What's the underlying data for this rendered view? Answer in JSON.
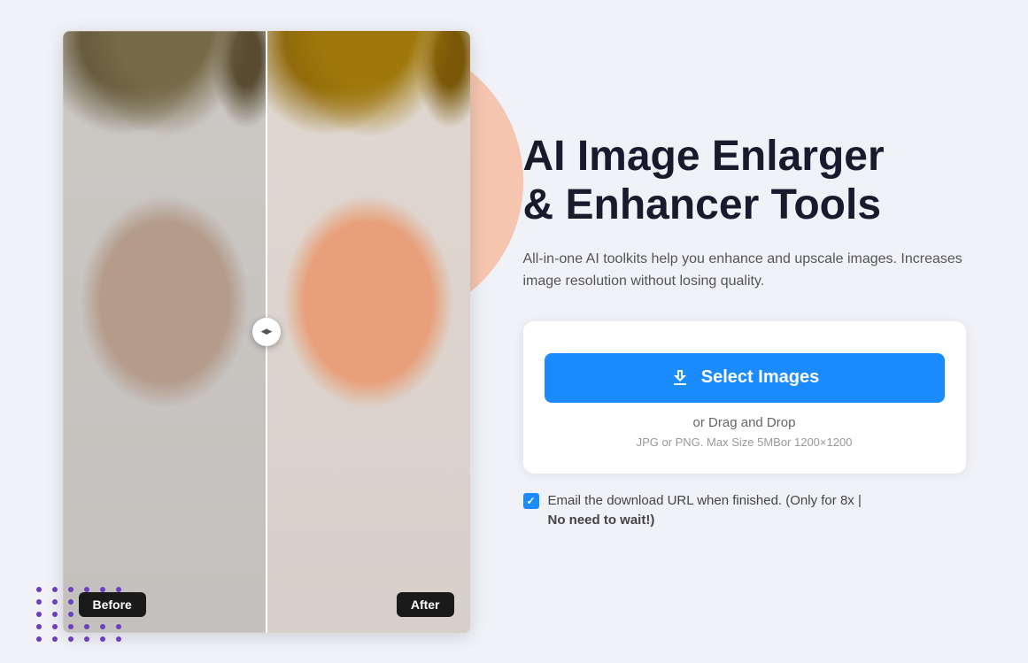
{
  "page": {
    "bg_color": "#f0f2f8"
  },
  "hero": {
    "title_line1": "AI Image Enlarger",
    "title_line2": "& Enhancer Tools",
    "subtitle": "All-in-one AI toolkits help you enhance and upscale images. Increases image resolution without losing quality."
  },
  "upload_box": {
    "select_button_label": "Select Images",
    "drag_drop_label": "or Drag and Drop",
    "file_constraints": "JPG or PNG. Max Size 5MBor 1200×1200"
  },
  "email_notice": {
    "line1": "Email the download URL when finished. (Only for 8x |",
    "line2": "No need to wait!)"
  },
  "comparison": {
    "before_label": "Before",
    "after_label": "After"
  },
  "dot_grid_count": 30,
  "icons": {
    "upload": "upload-icon",
    "checkbox": "checkbox-icon"
  }
}
